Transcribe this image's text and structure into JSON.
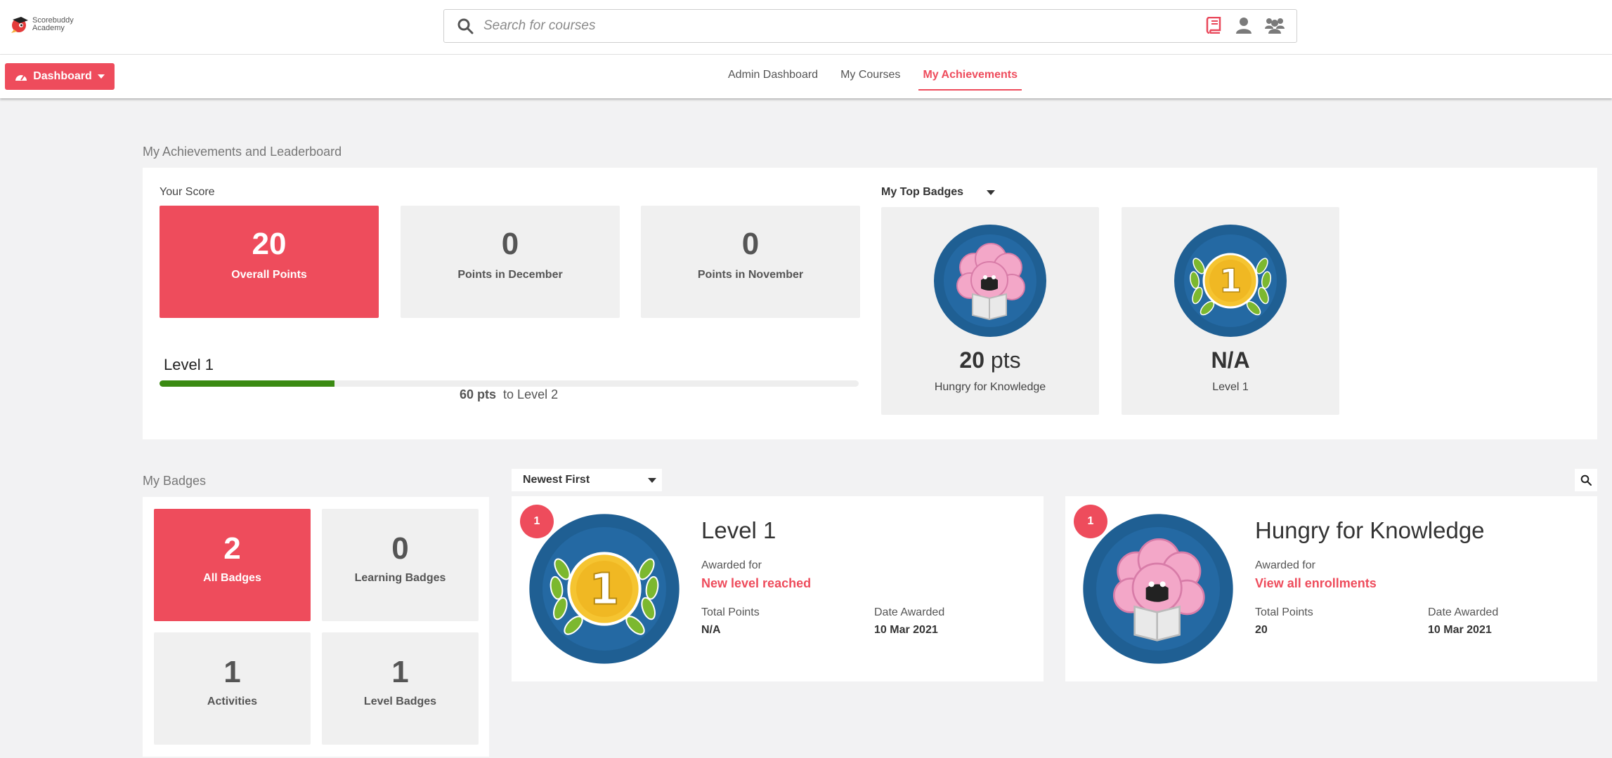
{
  "header": {
    "logo_line1": "Scorebuddy",
    "logo_line2": "Academy",
    "search_placeholder": "Search for courses",
    "icons": [
      "search-icon",
      "book-icon",
      "user-icon",
      "group-icon"
    ]
  },
  "nav": {
    "dashboard_label": "Dashboard",
    "tabs": [
      {
        "label": "Admin Dashboard",
        "active": false
      },
      {
        "label": "My Courses",
        "active": false
      },
      {
        "label": "My Achievements",
        "active": true
      }
    ]
  },
  "achievements": {
    "section_title": "My Achievements and Leaderboard",
    "your_score_label": "Your Score",
    "scores": [
      {
        "value": "20",
        "caption": "Overall Points"
      },
      {
        "value": "0",
        "caption": "Points in December"
      },
      {
        "value": "0",
        "caption": "Points in November"
      }
    ],
    "level_label": "Level 1",
    "progress_fraction": 0.25,
    "progress_pts": "60 pts",
    "progress_suffix": "to Level 2",
    "top_badges_label": "My Top Badges",
    "top_badges": [
      {
        "value": "20",
        "unit": "pts",
        "name": "Hungry for Knowledge",
        "icon": "brain-badge-icon"
      },
      {
        "value": "N/A",
        "unit": "",
        "name": "Level 1",
        "icon": "level-1-laurel-badge-icon"
      }
    ]
  },
  "badges": {
    "section_title": "My Badges",
    "tiles": [
      {
        "value": "2",
        "caption": "All Badges"
      },
      {
        "value": "0",
        "caption": "Learning Badges"
      },
      {
        "value": "1",
        "caption": "Activities"
      },
      {
        "value": "1",
        "caption": "Level Badges"
      }
    ],
    "sort_label": "Newest First",
    "awards": [
      {
        "count": "1",
        "title": "Level 1",
        "awarded_for_label": "Awarded for",
        "awarded_for": "New level reached",
        "total_points_label": "Total Points",
        "total_points": "N/A",
        "date_label": "Date Awarded",
        "date": "10 Mar 2021",
        "icon": "level-1-laurel-badge-icon"
      },
      {
        "count": "1",
        "title": "Hungry for Knowledge",
        "awarded_for_label": "Awarded for",
        "awarded_for": "View all enrollments",
        "total_points_label": "Total Points",
        "total_points": "20",
        "date_label": "Date Awarded",
        "date": "10 Mar 2021",
        "icon": "brain-badge-icon"
      }
    ]
  },
  "colors": {
    "accent": "#ee4c5c",
    "progress": "#3a8a12",
    "badge_ring": "#1f5f93",
    "gold": "#f5c431",
    "laurel": "#7cb82f",
    "brain": "#f3a7c8"
  }
}
